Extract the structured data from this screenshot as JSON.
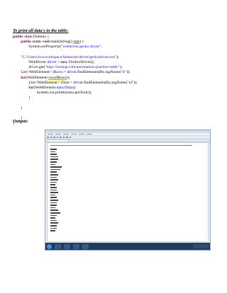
{
  "document": {
    "heading": "To print all data's in the table:",
    "output_label": "Output:",
    "code_lines": [
      [
        {
          "t": "public class",
          "c": "kw"
        },
        {
          "t": " Dummy {",
          "c": ""
        }
      ],
      [
        {
          "t": "        ",
          "c": ""
        },
        {
          "t": "public static void",
          "c": "kw"
        },
        {
          "t": " main(String[] ",
          "c": ""
        },
        {
          "t": "args",
          "c": "underline"
        },
        {
          "t": ") {",
          "c": ""
        }
      ],
      [
        {
          "t": "                System.",
          "c": ""
        },
        {
          "t": "setProperty",
          "c": "ital"
        },
        {
          "t": "(",
          "c": ""
        },
        {
          "t": "\"webdriver.gecko.driver\"",
          "c": "str"
        },
        {
          "t": ",",
          "c": ""
        }
      ],
      [
        {
          "t": "",
          "c": ""
        }
      ],
      [
        {
          "t": "        ",
          "c": ""
        },
        {
          "t": "\"C:/Users/siva/workspace/Selenium/driver/geckodriver.exe\"",
          "c": "str"
        },
        {
          "t": ");",
          "c": ""
        }
      ],
      [
        {
          "t": "                WebDriver ",
          "c": ""
        },
        {
          "t": "driver",
          "c": "fld"
        },
        {
          "t": " = ",
          "c": ""
        },
        {
          "t": "new",
          "c": "kw"
        },
        {
          "t": " FirefoxDriver();",
          "c": ""
        }
      ],
      [
        {
          "t": "                ",
          "c": ""
        },
        {
          "t": "driver",
          "c": "fld"
        },
        {
          "t": ".get(",
          "c": ""
        },
        {
          "t": "\"http://toolsqa.com/automation-practice-table/\"",
          "c": "str"
        },
        {
          "t": ");",
          "c": ""
        }
      ],
      [
        {
          "t": "        List<WebElement> ",
          "c": ""
        },
        {
          "t": "iRows",
          "c": "fld"
        },
        {
          "t": " = ",
          "c": ""
        },
        {
          "t": "driver",
          "c": "fld"
        },
        {
          "t": ".findElements(By.",
          "c": ""
        },
        {
          "t": "tagName",
          "c": "ital"
        },
        {
          "t": "(",
          "c": ""
        },
        {
          "t": "\"tr\"",
          "c": "str"
        },
        {
          "t": "));",
          "c": ""
        }
      ],
      [
        {
          "t": "        ",
          "c": ""
        },
        {
          "t": "for",
          "c": "kw"
        },
        {
          "t": "(WebElement ",
          "c": ""
        },
        {
          "t": "rowsIRows",
          "c": "underline"
        },
        {
          "t": "){",
          "c": ""
        }
      ],
      [
        {
          "t": "                List<WebElement> ",
          "c": ""
        },
        {
          "t": "iData",
          "c": "fld"
        },
        {
          "t": " = ",
          "c": ""
        },
        {
          "t": "driver",
          "c": "fld"
        },
        {
          "t": ".findElements(By.",
          "c": ""
        },
        {
          "t": "tagName",
          "c": "ital"
        },
        {
          "t": "(",
          "c": ""
        },
        {
          "t": "\"td\"",
          "c": "str"
        },
        {
          "t": "));",
          "c": ""
        }
      ],
      [
        {
          "t": "                ",
          "c": ""
        },
        {
          "t": "for",
          "c": "kw"
        },
        {
          "t": "(WebElement ",
          "c": ""
        },
        {
          "t": "data:iData",
          "c": "fld"
        },
        {
          "t": "){",
          "c": ""
        }
      ],
      [
        {
          "t": "                        System.",
          "c": ""
        },
        {
          "t": "out",
          "c": "fld"
        },
        {
          "t": ".println(",
          "c": ""
        },
        {
          "t": "data",
          "c": "fld"
        },
        {
          "t": ".getText());",
          "c": ""
        }
      ],
      [
        {
          "t": "                }",
          "c": ""
        }
      ],
      [
        {
          "t": "",
          "c": ""
        }
      ],
      [
        {
          "t": "        }",
          "c": ""
        }
      ],
      [
        {
          "t": "",
          "c": ""
        }
      ],
      [
        {
          "t": "        }",
          "c": ""
        }
      ],
      [
        {
          "t": "}",
          "c": ""
        }
      ]
    ]
  },
  "screenshot": {
    "console_line_widths": [
      0.04,
      0.03,
      0.04,
      0.05,
      0.05,
      0.04,
      0.03,
      0.07,
      0.06,
      0.04,
      0.05,
      0.04,
      0.05,
      0.04,
      0.03,
      0.04,
      0.04,
      0.05,
      0.03,
      0.04,
      0.05,
      0.04,
      0.04,
      0.03,
      0.05,
      0.06,
      0.04,
      0.03,
      0.04,
      0.05,
      0.04,
      0.04,
      0.03
    ],
    "colors": {
      "window_border": "#8ea4c4",
      "taskbar": "#1f3b5e",
      "start": "#4f8cd8"
    }
  }
}
